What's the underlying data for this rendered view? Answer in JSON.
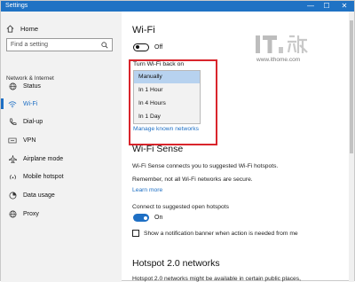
{
  "window": {
    "title": "Settings",
    "controls": {
      "minimize": "—",
      "maximize": "☐",
      "close": "✕"
    }
  },
  "sidebar": {
    "home_label": "Home",
    "search_placeholder": "Find a setting",
    "section_label": "Network & Internet",
    "items": [
      {
        "label": "Status",
        "icon": "globe-icon"
      },
      {
        "label": "Wi-Fi",
        "icon": "wifi-icon",
        "active": true
      },
      {
        "label": "Dial-up",
        "icon": "phone-icon"
      },
      {
        "label": "VPN",
        "icon": "vpn-icon"
      },
      {
        "label": "Airplane mode",
        "icon": "airplane-icon"
      },
      {
        "label": "Mobile hotspot",
        "icon": "hotspot-icon"
      },
      {
        "label": "Data usage",
        "icon": "data-usage-icon"
      },
      {
        "label": "Proxy",
        "icon": "globe-icon"
      }
    ]
  },
  "wifi": {
    "title": "Wi-Fi",
    "toggle_state": "Off",
    "turn_back_label": "Turn Wi-Fi back on",
    "options": [
      "Manually",
      "In 1 Hour",
      "In 4 Hours",
      "In 1 Day"
    ],
    "selected": "Manually",
    "manage_link": "Manage known networks"
  },
  "wifi_sense": {
    "title": "Wi-Fi Sense",
    "description": "Wi-Fi Sense connects you to suggested Wi-Fi hotspots.",
    "remember": "Remember, not all Wi-Fi networks are secure.",
    "learn_more": "Learn more",
    "connect_label": "Connect to suggested open hotspots",
    "connect_state": "On",
    "banner_label": "Show a notification banner when action is needed from me"
  },
  "hotspot": {
    "title": "Hotspot 2.0 networks",
    "description": "Hotspot 2.0 networks might be available in certain public places,"
  },
  "watermark": {
    "url": "www.ithome.com"
  },
  "colors": {
    "accent": "#1e6fc4",
    "titlebar": "#1f72c4",
    "highlight_box": "#d9252c",
    "selected_option": "#b7d2ef"
  }
}
